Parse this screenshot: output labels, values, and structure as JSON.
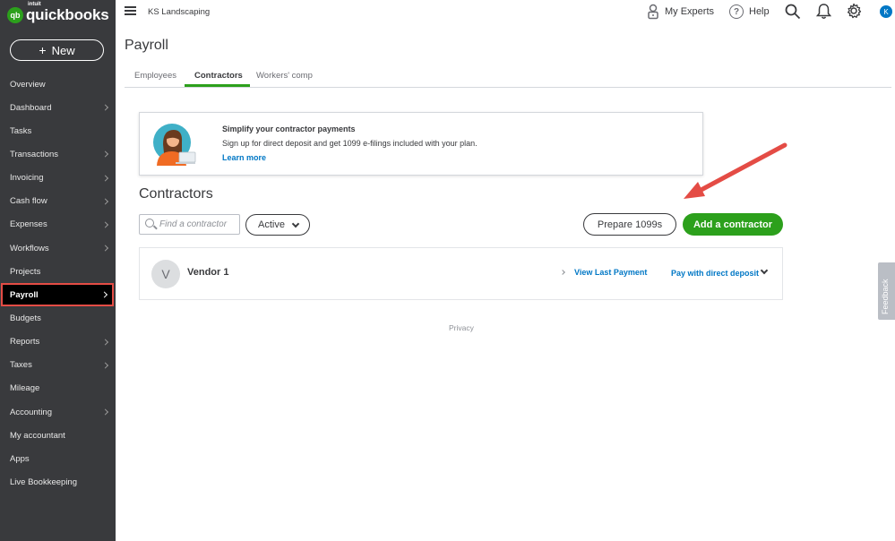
{
  "brand": {
    "intuit": "intuit",
    "name": "quickbooks",
    "mark": "qb"
  },
  "sidebar": {
    "new_label": "New",
    "items": [
      {
        "label": "Overview",
        "chevron": false
      },
      {
        "label": "Dashboard",
        "chevron": true
      },
      {
        "label": "Tasks",
        "chevron": false
      },
      {
        "label": "Transactions",
        "chevron": true
      },
      {
        "label": "Invoicing",
        "chevron": true
      },
      {
        "label": "Cash flow",
        "chevron": true
      },
      {
        "label": "Expenses",
        "chevron": true
      },
      {
        "label": "Workflows",
        "chevron": true
      },
      {
        "label": "Projects",
        "chevron": false
      },
      {
        "label": "Payroll",
        "chevron": true,
        "active": true
      },
      {
        "label": "Budgets",
        "chevron": false
      },
      {
        "label": "Reports",
        "chevron": true
      },
      {
        "label": "Taxes",
        "chevron": true
      },
      {
        "label": "Mileage",
        "chevron": false
      },
      {
        "label": "Accounting",
        "chevron": true
      },
      {
        "label": "My accountant",
        "chevron": false
      },
      {
        "label": "Apps",
        "chevron": false
      },
      {
        "label": "Live Bookkeeping",
        "chevron": false
      }
    ]
  },
  "topbar": {
    "company": "KS Landscaping",
    "my_experts": "My Experts",
    "help": "Help",
    "avatar_initial": "K"
  },
  "page": {
    "title": "Payroll",
    "tabs": [
      {
        "label": "Employees",
        "active": false
      },
      {
        "label": "Contractors",
        "active": true
      },
      {
        "label": "Workers' comp",
        "active": false
      }
    ]
  },
  "promo": {
    "title": "Simplify your contractor payments",
    "body": "Sign up for direct deposit and get 1099 e-filings included with your plan.",
    "link": "Learn more"
  },
  "contractors": {
    "title": "Contractors",
    "search_placeholder": "Find a contractor",
    "filter_value": "Active",
    "prepare_button": "Prepare 1099s",
    "add_button": "Add a contractor",
    "rows": [
      {
        "initial": "V",
        "name": "Vendor 1",
        "view_link": "View Last Payment",
        "pay_link": "Pay with direct deposit"
      }
    ]
  },
  "footer": {
    "privacy": "Privacy"
  },
  "feedback": "Feedback",
  "colors": {
    "sidebar_bg": "#393a3d",
    "accent_green": "#2ca01c",
    "link_blue": "#0077c5",
    "highlight_red": "#e44c45"
  }
}
